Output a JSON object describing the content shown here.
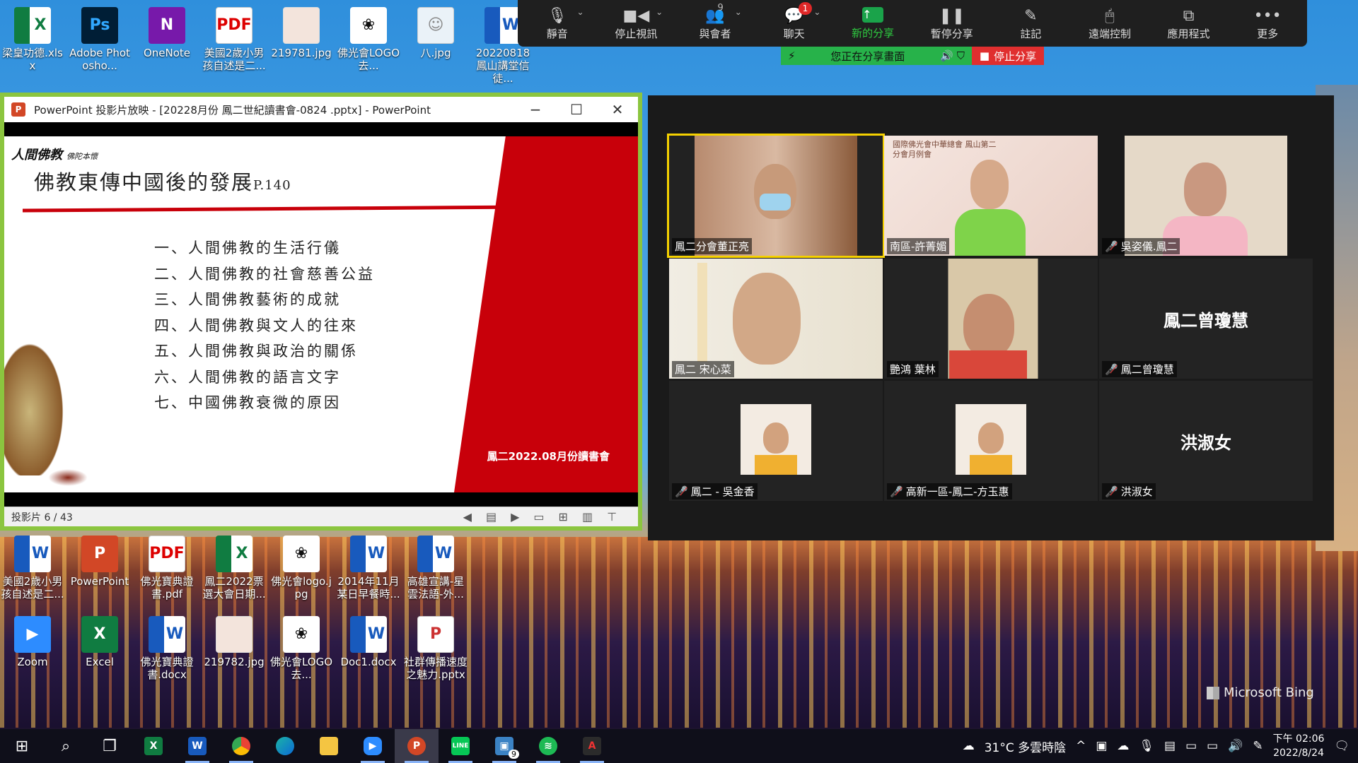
{
  "desktop": {
    "top_icons": [
      {
        "label": "梁皇功德.xlsx",
        "icon": "excel-file-icon"
      },
      {
        "label": "Adobe Photosho...",
        "icon": "photoshop-icon"
      },
      {
        "label": "OneNote",
        "icon": "onenote-icon"
      },
      {
        "label": "美國2歲小男孩自述是二...",
        "icon": "pdf-icon"
      },
      {
        "label": "219781.jpg",
        "icon": "image-file-icon"
      },
      {
        "label": "佛光會LOGO 去...",
        "icon": "lotus-logo-icon"
      },
      {
        "label": "八.jpg",
        "icon": "photo-file-icon"
      },
      {
        "label": "20220818 鳳山講堂信徒...",
        "icon": "word-file-icon"
      }
    ],
    "mid_icons": [
      {
        "label": "美國2歲小男孩自述是二...",
        "icon": "word-file-icon"
      },
      {
        "label": "PowerPoint",
        "icon": "powerpoint-icon"
      },
      {
        "label": "佛光寶典證書.pdf",
        "icon": "pdf-icon"
      },
      {
        "label": "鳳二2022票選大會日期...",
        "icon": "excel-file-icon"
      },
      {
        "label": "佛光會logo.jpg",
        "icon": "lotus-logo-icon"
      },
      {
        "label": "2014年11月某日早餐時...",
        "icon": "word-file-icon"
      },
      {
        "label": "高雄宣講-星雲法語-外...",
        "icon": "word-file-icon"
      }
    ],
    "bottom_icons": [
      {
        "label": "Zoom",
        "icon": "zoom-icon"
      },
      {
        "label": "Excel",
        "icon": "excel-app-icon"
      },
      {
        "label": "佛光寶典證書.docx",
        "icon": "word-file-icon"
      },
      {
        "label": "219782.jpg",
        "icon": "image-file-icon"
      },
      {
        "label": "佛光會LOGO 去...",
        "icon": "lotus-logo-icon"
      },
      {
        "label": "Doc1.docx",
        "icon": "word-file-icon"
      },
      {
        "label": "社群傳播速度之魅力.pptx",
        "icon": "pptx-file-icon"
      }
    ],
    "bing_label": "Microsoft Bing"
  },
  "zoom_toolbar": {
    "items": [
      {
        "label": "靜音",
        "icon": "microphone-icon",
        "caret": true
      },
      {
        "label": "停止視訊",
        "icon": "video-camera-icon",
        "caret": true
      },
      {
        "label": "與會者",
        "icon": "participants-icon",
        "caret": true,
        "count": "9"
      },
      {
        "label": "聊天",
        "icon": "chat-icon",
        "caret": true,
        "badge": "1"
      },
      {
        "label": "新的分享",
        "icon": "share-up-arrow-icon",
        "green": true
      },
      {
        "label": "暫停分享",
        "icon": "pause-icon"
      },
      {
        "label": "註記",
        "icon": "pencil-icon"
      },
      {
        "label": "遠端控制",
        "icon": "mouse-icon"
      },
      {
        "label": "應用程式",
        "icon": "apps-icon"
      },
      {
        "label": "更多",
        "icon": "more-dots-icon"
      }
    ],
    "sharing_status": "您正在分享畫面",
    "stop_share": "停止分享"
  },
  "ppt_window": {
    "title": "PowerPoint 投影片放映 - [20228月份 鳳二世紀讀書會-0824 .pptx] - PowerPoint",
    "app_badge": "P",
    "brand": "人間佛教",
    "brand_sub": "佛陀本懷",
    "slide_title": "佛教東傳中國後的發展",
    "slide_title_page": "P.140",
    "slide_items": [
      "一、人間佛教的生活行儀",
      "二、人間佛教的社會慈善公益",
      "三、人間佛教藝術的成就",
      "四、人間佛教與文人的往來",
      "五、人間佛教與政治的關係",
      "六、人間佛教的語言文字",
      "七、中國佛教衰微的原因"
    ],
    "slide_footer": "鳳二2022.08月份讀書會",
    "status": "投影片 6 / 43"
  },
  "gallery": {
    "tiles": [
      {
        "name": "鳳二分會董正亮",
        "muted": false,
        "active": true,
        "type": "video"
      },
      {
        "name": "南區-許菁媚",
        "muted": false,
        "active": false,
        "type": "video"
      },
      {
        "name": "吳姿儀.鳳二",
        "muted": true,
        "active": false,
        "type": "video"
      },
      {
        "name": "鳳二 宋心菜",
        "muted": false,
        "active": false,
        "type": "video"
      },
      {
        "name": "艷鴻 葉林",
        "muted": false,
        "active": false,
        "type": "video"
      },
      {
        "name": "鳳二曾瓊慧",
        "muted": true,
        "active": false,
        "type": "name",
        "big": "鳳二曾瓊慧"
      },
      {
        "name": "鳳二 - 吳金香",
        "muted": true,
        "active": false,
        "type": "avatar"
      },
      {
        "name": "高新一區-鳳二-方玉惠",
        "muted": true,
        "active": false,
        "type": "avatar"
      },
      {
        "name": "洪淑女",
        "muted": true,
        "active": false,
        "type": "name",
        "big": "洪淑女"
      }
    ],
    "tile2_banner": "國際佛光會中華總會 鳳山第二分會月例會"
  },
  "taskbar": {
    "apps": [
      "start-icon",
      "search-icon",
      "task-view-icon",
      "excel-icon",
      "word-icon",
      "chrome-icon",
      "edge-icon",
      "file-explorer-icon",
      "zoom-icon",
      "powerpoint-icon",
      "line-icon",
      "taskbar-app-badge-icon",
      "spotify-icon",
      "acrobat-icon"
    ],
    "app_badge_count": "9",
    "weather": "31°C 多雲時陰",
    "time_period": "下午 02:06",
    "date": "2022/8/24"
  },
  "colors": {
    "ppt_border": "#8bc53f",
    "slide_red": "#c8000a",
    "zoom_green": "#27b24a",
    "zoom_stop_red": "#e02f2f",
    "active_speaker": "#f5d100"
  }
}
